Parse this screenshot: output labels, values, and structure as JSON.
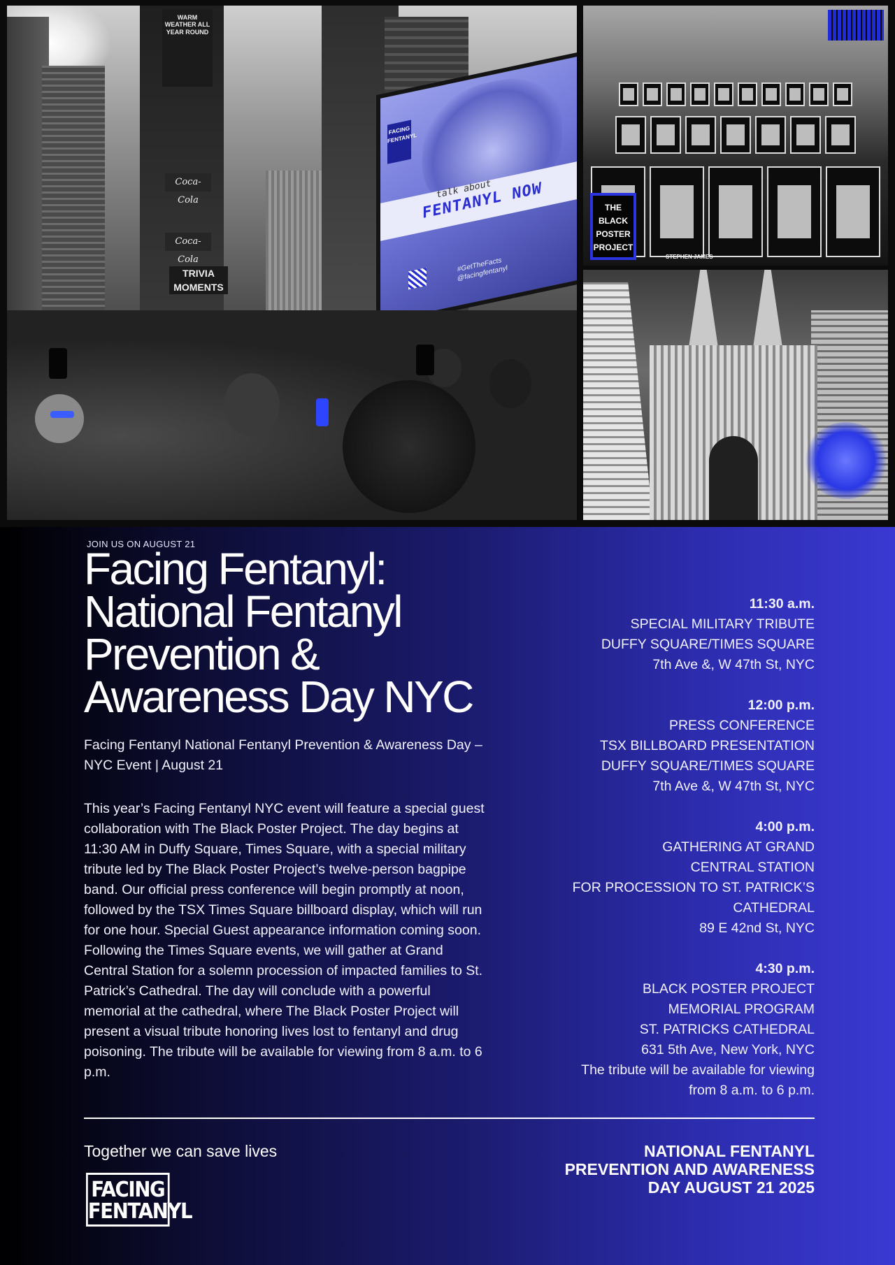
{
  "collage": {
    "times_square": {
      "billboard_top": "WARM WEATHER ALL YEAR ROUND",
      "coke_sign": "Coca-Cola",
      "trivia_sign": "TRIVIA MOMENTS",
      "screen": {
        "brand": "FACING FENTANYL",
        "kicker": "talk about",
        "headline": "FENTANYL NOW",
        "hashtag": "#GetTheFacts",
        "handle": "@facingfentanyl"
      }
    },
    "posters": {
      "badge": "THE BLACK POSTER PROJECT",
      "caption": "STEPHEN JAMES"
    },
    "cathedral": {}
  },
  "info": {
    "kicker": "JOIN US ON AUGUST 21",
    "headline": "Facing Fentanyl: National Fentanyl Prevention & Awareness Day NYC",
    "subline": "Facing Fentanyl National Fentanyl Prevention & Awareness Day – NYC Event | August 21",
    "body": "This year’s Facing Fentanyl NYC event will feature a special guest collaboration with The Black Poster Project. The day begins at 11:30 AM in Duffy Square, Times Square, with a special military tribute led by The Black Poster Project’s twelve-person bagpipe band. Our official press conference will begin promptly at noon, followed by the TSX Times Square billboard display, which will run for one hour. Special Guest appearance information coming soon. Following the Times Square events, we will gather at Grand Central Station for a solemn procession of impacted families to St. Patrick’s Cathedral. The day will conclude with a powerful memorial at the cathedral, where The Black Poster Project will present a visual tribute honoring lives lost to fentanyl and drug poisoning. The tribute will be available for viewing from 8 a.m. to 6 p.m."
  },
  "schedule": [
    {
      "time": "11:30 a.m.",
      "lines": [
        "SPECIAL MILITARY TRIBUTE",
        "DUFFY SQUARE/TIMES SQUARE",
        "7th Ave &, W 47th St, NYC"
      ]
    },
    {
      "time": "12:00 p.m.",
      "lines": [
        "PRESS CONFERENCE",
        "TSX BILLBOARD PRESENTATION",
        "DUFFY SQUARE/TIMES SQUARE",
        "7th Ave &, W 47th St, NYC"
      ]
    },
    {
      "time": "4:00 p.m.",
      "lines": [
        "GATHERING AT GRAND",
        "CENTRAL STATION",
        "FOR PROCESSION TO ST. PATRICK’S",
        "CATHEDRAL",
        "89 E 42nd St, NYC"
      ]
    },
    {
      "time": "4:30 p.m.",
      "lines": [
        "BLACK POSTER PROJECT",
        "MEMORIAL PROGRAM",
        "ST. PATRICKS CATHEDRAL",
        "631 5th Ave, New York, NYC",
        "The tribute will be available for viewing",
        "from 8 a.m. to 6 p.m."
      ]
    }
  ],
  "footer": {
    "tagline": "Together we can save lives",
    "logo_line1": "FACING",
    "logo_line2": "FENTANYL",
    "closing": "NATIONAL FENTANYL PREVENTION AND AWARENESS DAY AUGUST 21 2025"
  },
  "colors": {
    "gradient_dark": "#000000",
    "gradient_mid": "#1b1b6e",
    "gradient_light": "#3a39d2",
    "accent_blue": "#2a35e0"
  }
}
